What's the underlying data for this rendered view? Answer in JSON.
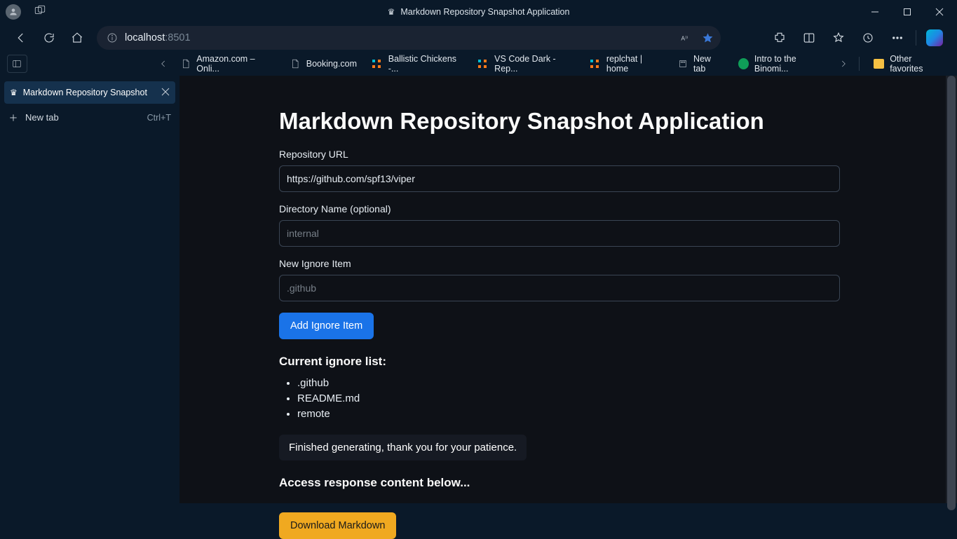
{
  "window": {
    "title": "Markdown Repository Snapshot Application"
  },
  "address": {
    "host": "localhost",
    "port": ":8501"
  },
  "bookmarks": [
    {
      "label": "Amazon.com – Onli...",
      "icon": "doc"
    },
    {
      "label": "Booking.com",
      "icon": "doc"
    },
    {
      "label": "Ballistic Chickens -...",
      "icon": "squares"
    },
    {
      "label": "VS Code Dark - Rep...",
      "icon": "squares"
    },
    {
      "label": "replchat | home",
      "icon": "squares"
    },
    {
      "label": "New tab",
      "icon": "box"
    },
    {
      "label": "Intro to the Binomi...",
      "icon": "green"
    }
  ],
  "bookmarks_other": "Other favorites",
  "vtab": {
    "title": "Markdown Repository Snapshot",
    "newtab_label": "New tab",
    "newtab_shortcut": "Ctrl+T"
  },
  "app": {
    "heading": "Markdown Repository Snapshot Application",
    "repo_label": "Repository URL",
    "repo_value": "https://github.com/spf13/viper",
    "dir_label": "Directory Name (optional)",
    "dir_placeholder": "internal",
    "ignore_label": "New Ignore Item",
    "ignore_placeholder": ".github",
    "add_ignore_btn": "Add Ignore Item",
    "ignore_list_heading": "Current ignore list:",
    "ignore_items": [
      ".github",
      "README.md",
      "remote"
    ],
    "status_msg": "Finished generating, thank you for your patience.",
    "access_heading": "Access response content below...",
    "download_btn": "Download Markdown"
  }
}
